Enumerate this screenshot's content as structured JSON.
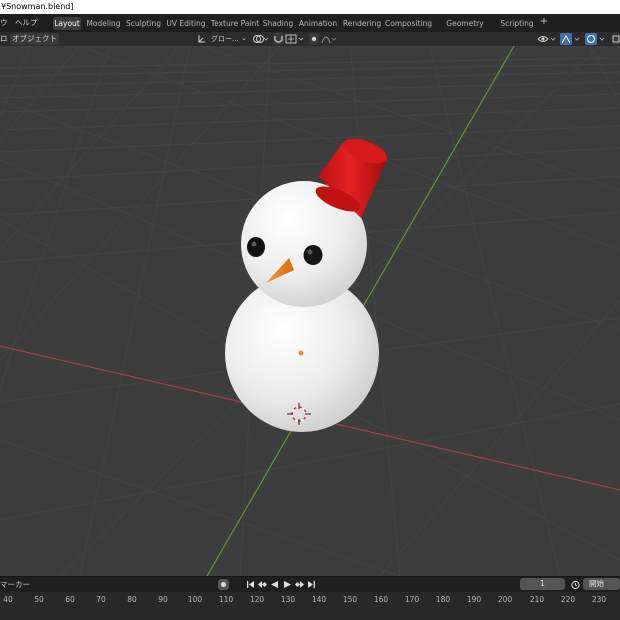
{
  "window": {
    "title": "¥Snowman.blend]"
  },
  "menubar": {
    "items": [
      "ウ",
      "ヘルプ"
    ],
    "workspaces": [
      "Layout",
      "Modeling",
      "Sculpting",
      "UV Editing",
      "Texture Paint",
      "Shading",
      "Animation",
      "Rendering",
      "Compositing",
      "Geometry Nodes",
      "Scripting"
    ],
    "active_workspace": "Layout",
    "add_tab": "+"
  },
  "viewport_header": {
    "left_label": "ロ",
    "object_menu": "オブジェクト",
    "transform_orientation": "グロー...",
    "chevron": "⌄"
  },
  "timeline": {
    "markers_label": "マーカー",
    "current_frame": "1",
    "start_label": "開始",
    "ruler_ticks": [
      "40",
      "50",
      "60",
      "70",
      "80",
      "90",
      "100",
      "110",
      "120",
      "130",
      "140",
      "150",
      "160",
      "170",
      "180",
      "190",
      "200",
      "210",
      "220",
      "230"
    ]
  },
  "colors": {
    "viewport_bg": "#3d3d3d",
    "x_axis": "#a8404a",
    "y_axis": "#6a9a2a",
    "hat": "#cc1515",
    "nose": "#e07a20",
    "snow": "#f0f0f0"
  }
}
